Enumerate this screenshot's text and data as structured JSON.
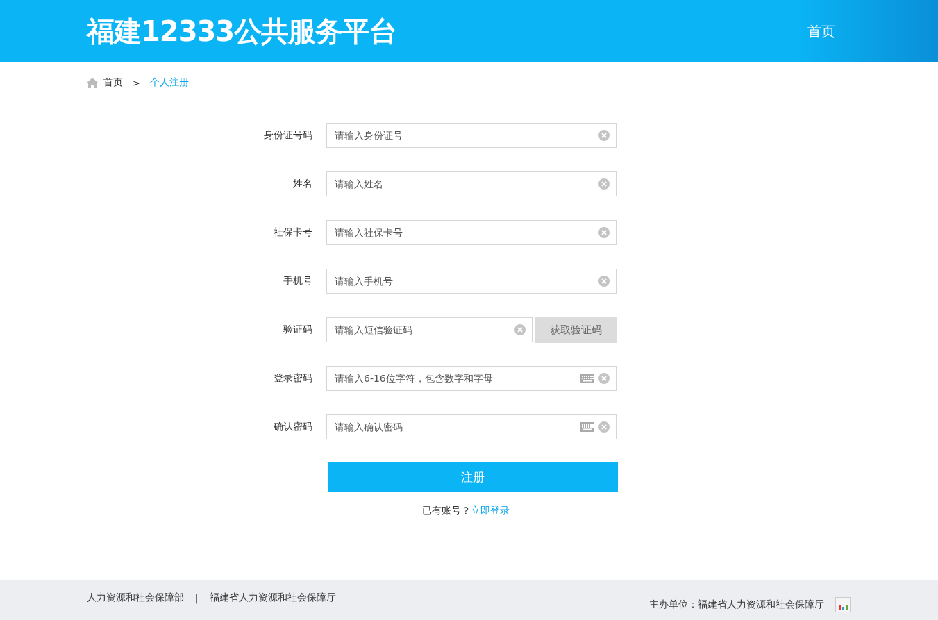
{
  "header": {
    "logo": "福建12333公共服务平台",
    "nav": [
      {
        "label": "首页"
      }
    ]
  },
  "breadcrumb": {
    "items": [
      {
        "label": "首页",
        "selected": false
      },
      {
        "label": "个人注册",
        "selected": true
      }
    ],
    "separator": ">"
  },
  "form": {
    "fields": [
      {
        "kind": "plain",
        "label": "身份证号码",
        "placeholder": "请输入身份证号"
      },
      {
        "kind": "plain",
        "label": "姓名",
        "placeholder": "请输入姓名"
      },
      {
        "kind": "plain",
        "label": "社保卡号",
        "placeholder": "请输入社保卡号"
      },
      {
        "kind": "plain",
        "label": "手机号",
        "placeholder": "请输入手机号"
      },
      {
        "kind": "sms",
        "label": "验证码",
        "placeholder": "请输入短信验证码",
        "button": "获取验证码"
      },
      {
        "kind": "password",
        "label": "登录密码",
        "placeholder": "请输入6-16位字符，包含数字和字母"
      },
      {
        "kind": "password",
        "label": "确认密码",
        "placeholder": "请输入确认密码"
      }
    ],
    "submit": "注册",
    "login_prompt": "已有账号？",
    "login_link": "立即登录"
  },
  "footer": {
    "links": [
      "人力资源和社会保障部",
      "福建省人力资源和社会保障厅"
    ],
    "divider": "|",
    "sponsor": "主办单位：福建省人力资源和社会保障厅"
  }
}
